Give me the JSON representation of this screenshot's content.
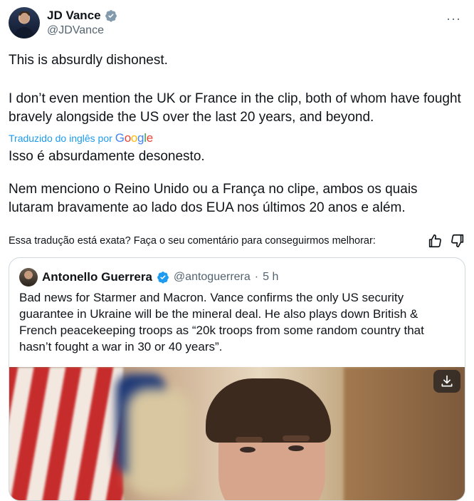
{
  "author": {
    "name": "JD Vance",
    "handle": "@JDVance",
    "verified_icon": "verified-badge-icon",
    "more_label": "···"
  },
  "tweet": {
    "original_p1": "This is absurdly dishonest.",
    "original_p2": "I don’t even mention the UK or France in the clip, both of whom have fought bravely alongside the US over the last 20 years, and beyond.",
    "translated_by": "Traduzido do inglês por",
    "translator_brand": "Google",
    "translated_p1": "Isso é absurdamente desonesto.",
    "translated_p2": "Nem menciono o Reino Unido ou a França no clipe, ambos os quais lutaram bravamente ao lado dos EUA nos últimos 20 anos e além."
  },
  "feedback": {
    "question": "Essa tradução está exata? Faça o seu comentário para conseguirmos melhorar:",
    "thumbs_up_icon": "thumbs-up-icon",
    "thumbs_down_icon": "thumbs-down-icon"
  },
  "quoted": {
    "name": "Antonello Guerrera",
    "handle": "@antoguerrera",
    "separator": "·",
    "time": "5 h",
    "text": "Bad news for Starmer and Macron. Vance confirms the only US security guarantee in Ukraine will be the mineral deal. He also plays down British & French peacekeeping troops as “20k troops from some random country that hasn’t fought a war in 30 or 40 years”.",
    "download_icon": "download-icon"
  },
  "colors": {
    "link_blue": "#1d9bf0",
    "text": "#0f1419",
    "secondary": "#536471",
    "border": "#cfd9de"
  }
}
